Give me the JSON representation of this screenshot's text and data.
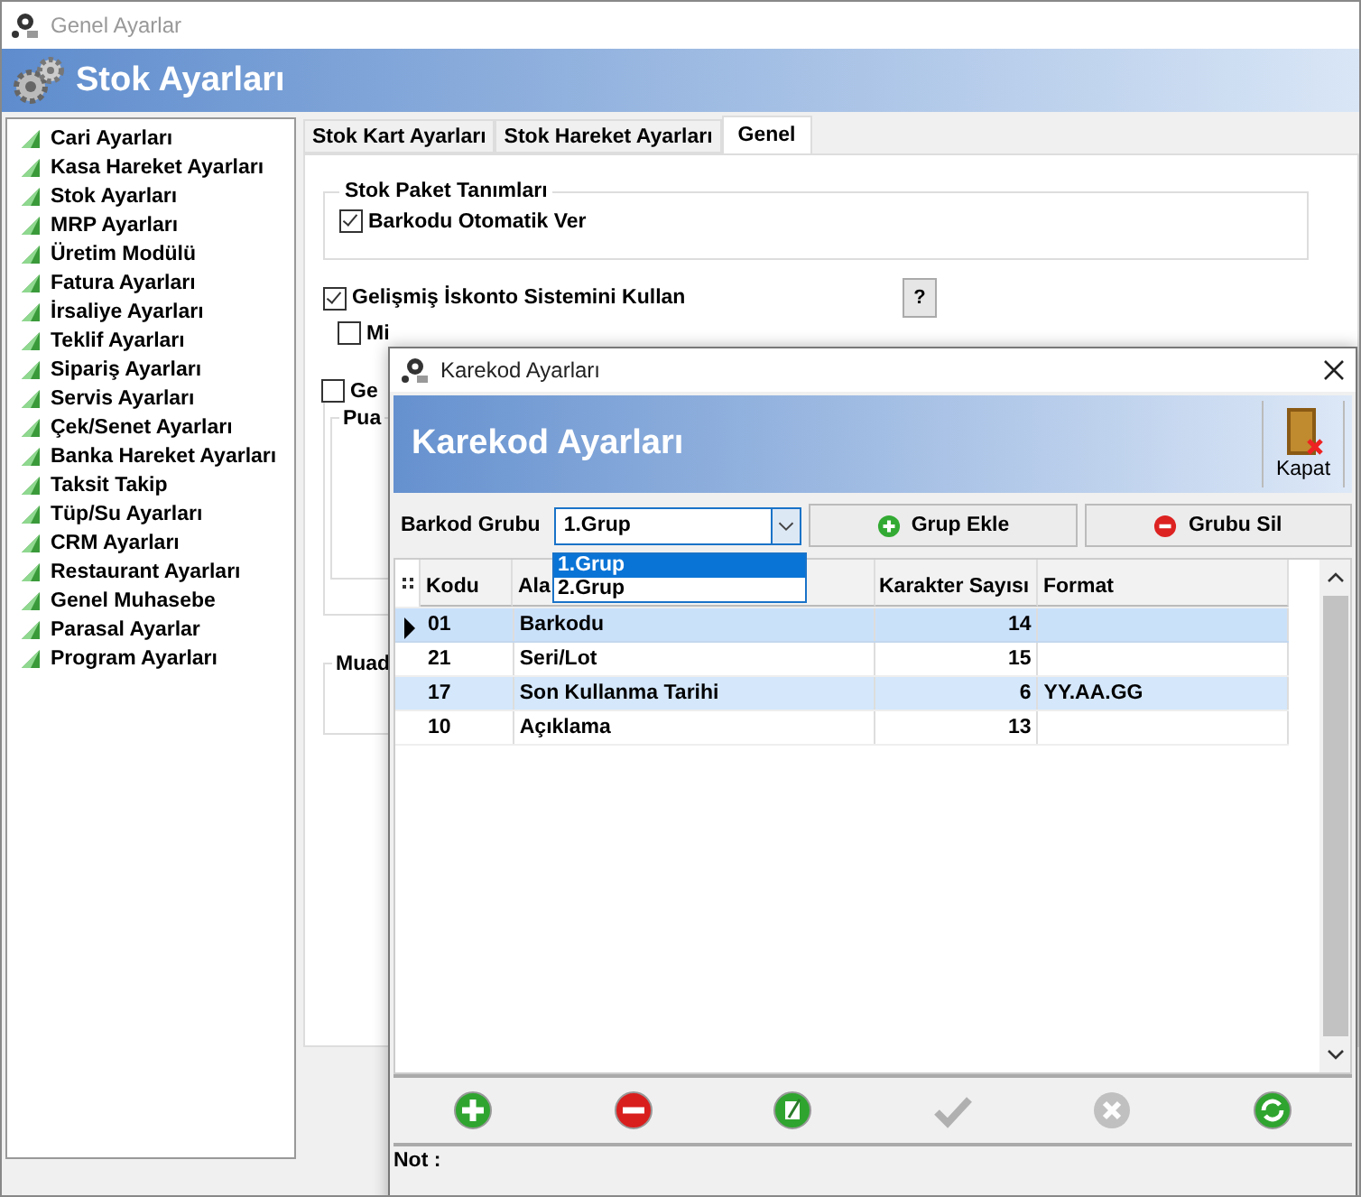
{
  "window": {
    "title": "Genel Ayarlar"
  },
  "header": {
    "title": "Stok Ayarları"
  },
  "sidebar": {
    "items": [
      {
        "label": "Cari Ayarları"
      },
      {
        "label": "Kasa Hareket Ayarları"
      },
      {
        "label": "Stok Ayarları"
      },
      {
        "label": "MRP Ayarları"
      },
      {
        "label": "Üretim Modülü"
      },
      {
        "label": "Fatura Ayarları"
      },
      {
        "label": "İrsaliye Ayarları"
      },
      {
        "label": "Teklif Ayarları"
      },
      {
        "label": "Sipariş Ayarları"
      },
      {
        "label": "Servis Ayarları"
      },
      {
        "label": "Çek/Senet Ayarları"
      },
      {
        "label": "Banka Hareket Ayarları"
      },
      {
        "label": "Taksit Takip"
      },
      {
        "label": "Tüp/Su Ayarları"
      },
      {
        "label": "CRM Ayarları"
      },
      {
        "label": "Restaurant Ayarları"
      },
      {
        "label": "Genel Muhasebe"
      },
      {
        "label": "Parasal Ayarlar"
      },
      {
        "label": "Program Ayarları"
      }
    ]
  },
  "tabs": [
    {
      "label": "Stok Kart Ayarları",
      "selected": false
    },
    {
      "label": "Stok Hareket Ayarları",
      "selected": false
    },
    {
      "label": "Genel",
      "selected": true
    }
  ],
  "genel": {
    "package_group": {
      "title": "Stok Paket Tanımları",
      "checkbox": {
        "label": "Barkodu Otomatik Ver",
        "checked": true
      }
    },
    "discount": {
      "label": "Gelişmiş İskonto Sistemini Kullan",
      "checked": true
    },
    "help_button": "?",
    "option_1": {
      "label": "Mi",
      "checked": false
    },
    "option_2": {
      "label": "Ge",
      "checked": false
    },
    "sub_group_title": "Pua",
    "group_title": "Muad"
  },
  "dialog": {
    "title": "Karekod Ayarları",
    "header": "Karekod Ayarları",
    "close_button": "Kapat",
    "barcode_group": {
      "label": "Barkod Grubu",
      "value": "1.Grup",
      "options": [
        {
          "label": "1.Grup",
          "selected": true
        },
        {
          "label": "2.Grup",
          "selected": false
        }
      ]
    },
    "add_button": "Grup Ekle",
    "delete_button": "Grubu Sil",
    "table": {
      "columns": [
        "Kodu",
        "Ala",
        "Karakter Sayısı",
        "Format"
      ],
      "rows": [
        {
          "cells": [
            "01",
            "Barkodu",
            "14",
            ""
          ],
          "current": true
        },
        {
          "cells": [
            "21",
            "Seri/Lot",
            "15",
            ""
          ],
          "current": false
        },
        {
          "cells": [
            "17",
            "Son Kullanma Tarihi",
            "6",
            "YY.AA.GG"
          ],
          "current": false
        },
        {
          "cells": [
            "10",
            "Açıklama",
            "13",
            ""
          ],
          "current": false
        }
      ]
    },
    "toolbar": [
      {
        "kind": "add",
        "disabled": false
      },
      {
        "kind": "remove",
        "disabled": false
      },
      {
        "kind": "edit",
        "disabled": false
      },
      {
        "kind": "confirm",
        "disabled": true
      },
      {
        "kind": "cancel",
        "disabled": true
      },
      {
        "kind": "refresh",
        "disabled": false
      }
    ],
    "note_label": "Not :"
  }
}
